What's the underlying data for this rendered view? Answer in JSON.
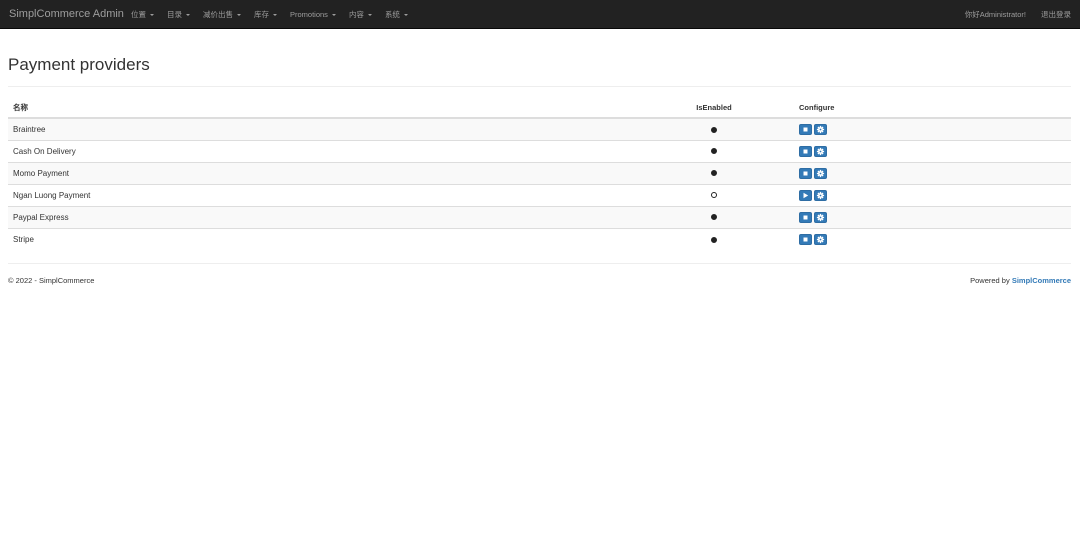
{
  "navbar": {
    "brand": "SimplCommerce Admin",
    "menu": [
      {
        "label": "位置",
        "icon": "caret-down-icon"
      },
      {
        "label": "目录",
        "icon": "caret-down-icon"
      },
      {
        "label": "减价出售",
        "icon": "caret-down-icon"
      },
      {
        "label": "库存",
        "icon": "caret-down-icon"
      },
      {
        "label": "Promotions",
        "icon": "caret-down-icon"
      },
      {
        "label": "内容",
        "icon": "caret-down-icon"
      },
      {
        "label": "系统",
        "icon": "caret-down-icon"
      }
    ],
    "greeting": "你好Administrator!",
    "logout": "退出登录"
  },
  "page": {
    "title": "Payment providers"
  },
  "table": {
    "headers": {
      "name": "名称",
      "enabled": "IsEnabled",
      "configure": "Configure"
    },
    "rows": [
      {
        "name": "Braintree",
        "enabled": true,
        "toggle_icon": "stop-icon",
        "settings_icon": "gear-icon"
      },
      {
        "name": "Cash On Delivery",
        "enabled": true,
        "toggle_icon": "stop-icon",
        "settings_icon": "gear-icon"
      },
      {
        "name": "Momo Payment",
        "enabled": true,
        "toggle_icon": "stop-icon",
        "settings_icon": "gear-icon"
      },
      {
        "name": "Ngan Luong Payment",
        "enabled": false,
        "toggle_icon": "play-icon",
        "settings_icon": "gear-icon"
      },
      {
        "name": "Paypal Express",
        "enabled": true,
        "toggle_icon": "stop-icon",
        "settings_icon": "gear-icon"
      },
      {
        "name": "Stripe",
        "enabled": true,
        "toggle_icon": "stop-icon",
        "settings_icon": "gear-icon"
      }
    ]
  },
  "footer": {
    "copyright": "© 2022 - SimplCommerce",
    "powered_by": "Powered by ",
    "powered_brand": "SimplCommerce"
  },
  "colors": {
    "navbar_bg": "#222222",
    "primary": "#337ab7",
    "row_stripe": "#f9f9f9"
  }
}
